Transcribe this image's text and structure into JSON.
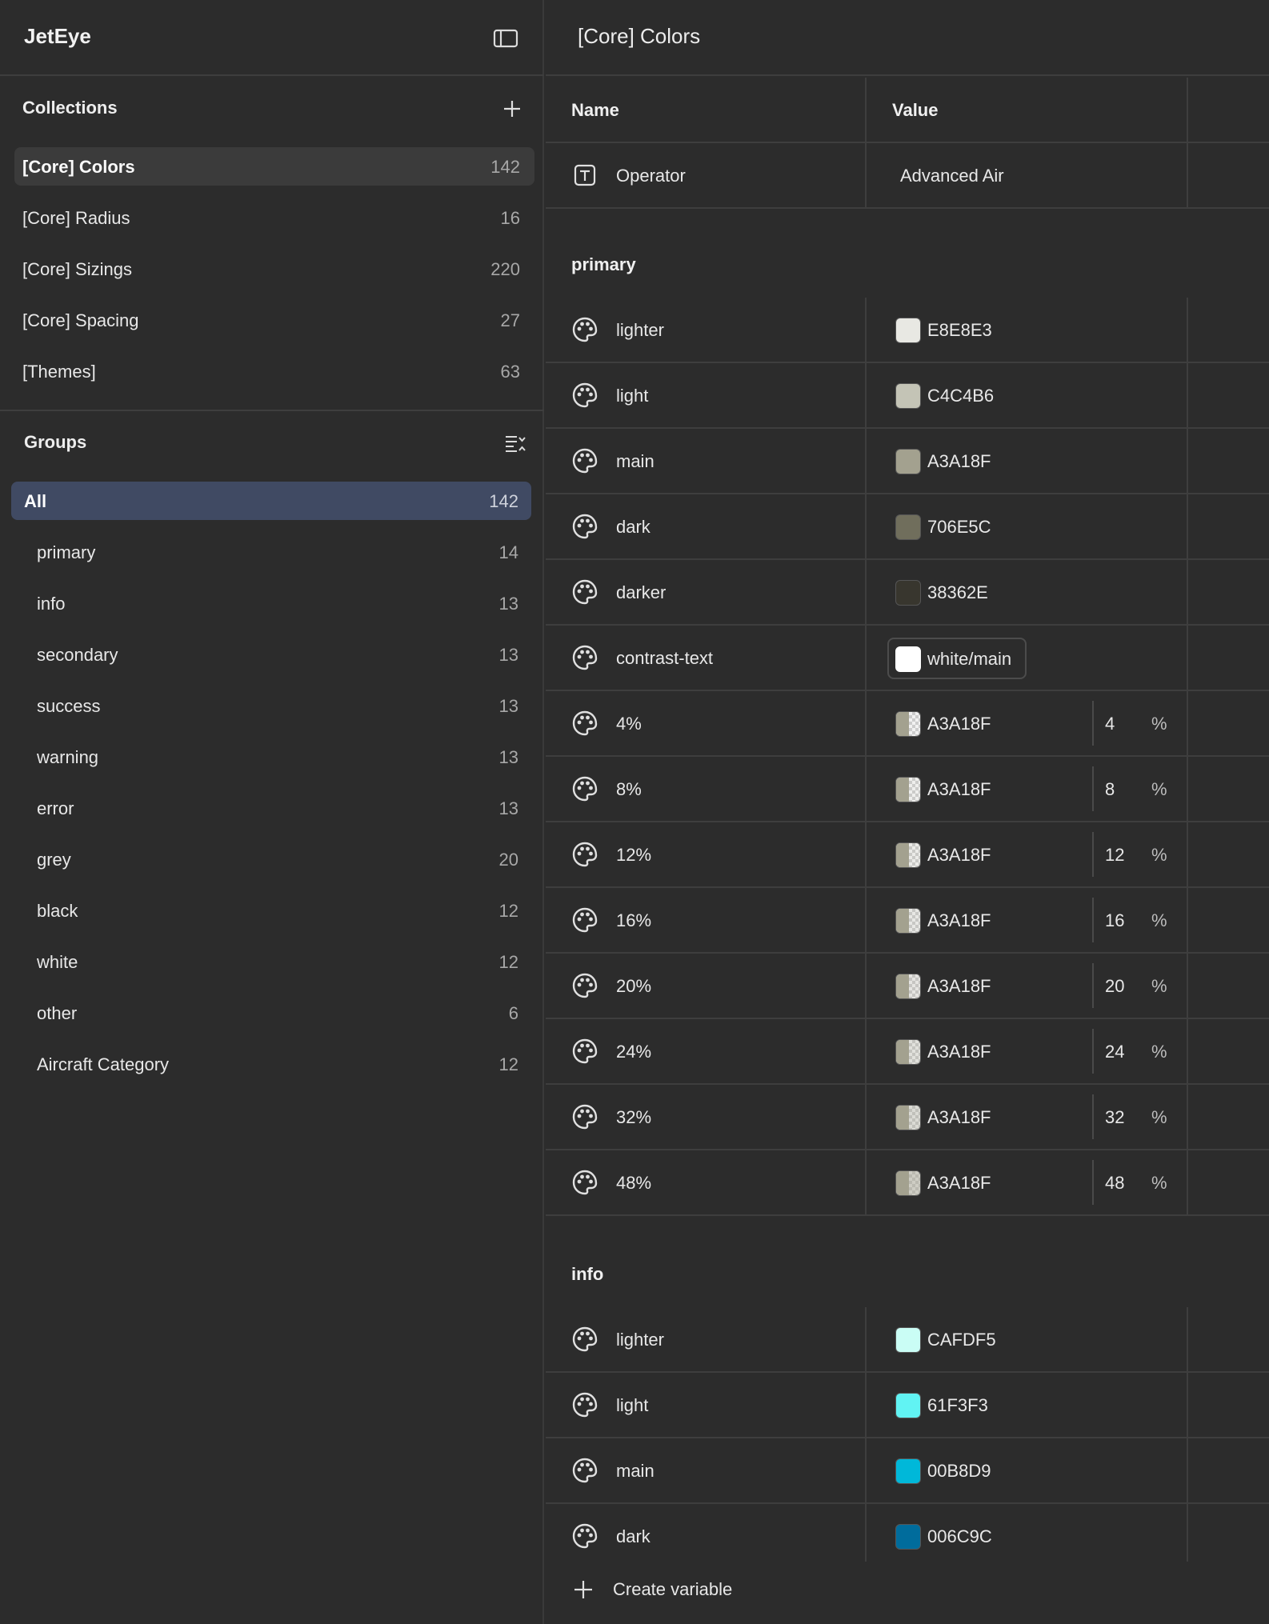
{
  "app": {
    "title": "JetEye"
  },
  "collections": {
    "title": "Collections",
    "items": [
      {
        "label": "[Core] Colors",
        "count": "142",
        "active": true
      },
      {
        "label": "[Core] Radius",
        "count": "16"
      },
      {
        "label": "[Core] Sizings",
        "count": "220"
      },
      {
        "label": "[Core] Spacing",
        "count": "27"
      },
      {
        "label": "[Themes]",
        "count": "63"
      }
    ]
  },
  "groups": {
    "title": "Groups",
    "items": [
      {
        "label": "All",
        "count": "142",
        "active": true
      },
      {
        "label": "primary",
        "count": "14"
      },
      {
        "label": "info",
        "count": "13"
      },
      {
        "label": "secondary",
        "count": "13"
      },
      {
        "label": "success",
        "count": "13"
      },
      {
        "label": "warning",
        "count": "13"
      },
      {
        "label": "error",
        "count": "13"
      },
      {
        "label": "grey",
        "count": "20"
      },
      {
        "label": "black",
        "count": "12"
      },
      {
        "label": "white",
        "count": "12"
      },
      {
        "label": "other",
        "count": "6"
      },
      {
        "label": "Aircraft Category",
        "count": "12"
      }
    ]
  },
  "main": {
    "title": "[Core] Colors",
    "columns": {
      "name": "Name",
      "value": "Value"
    },
    "operator": {
      "name": "Operator",
      "value": "Advanced Air",
      "icon": "text-type-icon"
    },
    "primary": {
      "header": "primary",
      "rows": [
        {
          "name": "lighter",
          "hex": "E8E8E3",
          "color": "#E8E8E3"
        },
        {
          "name": "light",
          "hex": "C4C4B6",
          "color": "#C4C4B6"
        },
        {
          "name": "main",
          "hex": "A3A18F",
          "color": "#A3A18F"
        },
        {
          "name": "dark",
          "hex": "706E5C",
          "color": "#706E5C"
        },
        {
          "name": "darker",
          "hex": "38362E",
          "color": "#38362E"
        },
        {
          "name": "contrast-text",
          "alias": "white/main",
          "color": "#FFFFFF"
        },
        {
          "name": "4%",
          "hex": "A3A18F",
          "opacity": "4",
          "unit": "%",
          "color": "#A3A18F"
        },
        {
          "name": "8%",
          "hex": "A3A18F",
          "opacity": "8",
          "unit": "%",
          "color": "#A3A18F"
        },
        {
          "name": "12%",
          "hex": "A3A18F",
          "opacity": "12",
          "unit": "%",
          "color": "#A3A18F"
        },
        {
          "name": "16%",
          "hex": "A3A18F",
          "opacity": "16",
          "unit": "%",
          "color": "#A3A18F"
        },
        {
          "name": "20%",
          "hex": "A3A18F",
          "opacity": "20",
          "unit": "%",
          "color": "#A3A18F"
        },
        {
          "name": "24%",
          "hex": "A3A18F",
          "opacity": "24",
          "unit": "%",
          "color": "#A3A18F"
        },
        {
          "name": "32%",
          "hex": "A3A18F",
          "opacity": "32",
          "unit": "%",
          "color": "#A3A18F"
        },
        {
          "name": "48%",
          "hex": "A3A18F",
          "opacity": "48",
          "unit": "%",
          "color": "#A3A18F"
        }
      ]
    },
    "info": {
      "header": "info",
      "rows": [
        {
          "name": "lighter",
          "hex": "CAFDF5",
          "color": "#CAFDF5"
        },
        {
          "name": "light",
          "hex": "61F3F3",
          "color": "#61F3F3"
        },
        {
          "name": "main",
          "hex": "00B8D9",
          "color": "#00B8D9"
        },
        {
          "name": "dark",
          "hex": "006C9C",
          "color": "#006C9C"
        }
      ]
    },
    "create_label": "Create variable"
  }
}
